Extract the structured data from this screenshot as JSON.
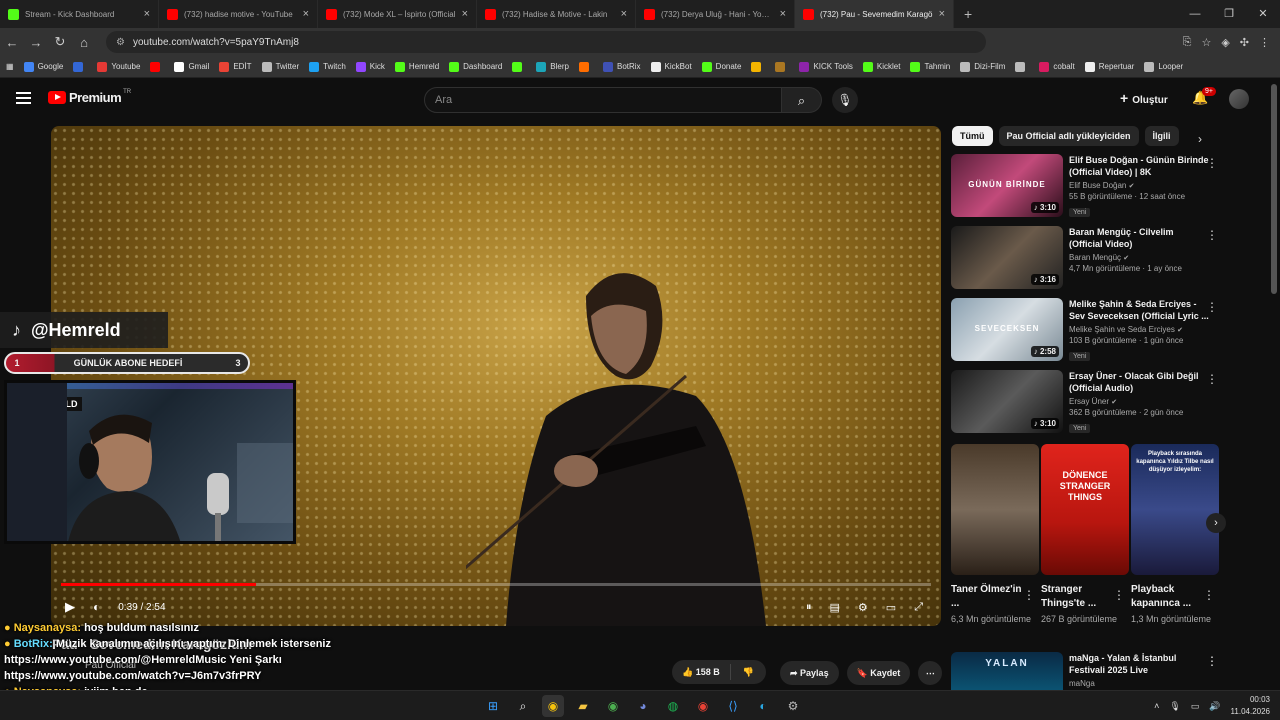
{
  "browser": {
    "tabs": [
      {
        "title": "Stream - Kick Dashboard",
        "favicon_color": "#53fc18",
        "active": false
      },
      {
        "title": "(732) hadise motive - YouTube",
        "favicon_color": "#ff0000",
        "active": false
      },
      {
        "title": "(732) Mode XL – İspirto (Official",
        "favicon_color": "#ff0000",
        "active": false
      },
      {
        "title": "(732) Hadise & Motive - Lakin",
        "favicon_color": "#ff0000",
        "active": false
      },
      {
        "title": "(732) Derya Uluğ - Hani - YouTu",
        "favicon_color": "#ff0000",
        "active": false
      },
      {
        "title": "(732) Pau - Sevemedim Karagö",
        "favicon_color": "#ff0000",
        "active": true
      }
    ],
    "new_tab": "+",
    "url": "youtube.com/watch?v=5paY9TnAmj8",
    "bookmarks": [
      "Google",
      "",
      "Youtube",
      "",
      "Gmail",
      "EDİT",
      "Twitter",
      "Twitch",
      "Kick",
      "Hemreld",
      "Dashboard",
      "",
      "Blerp",
      "",
      "BotRix",
      "KickBot",
      "Donate",
      "",
      "",
      "KICK Tools",
      "Kicklet",
      "Tahmin",
      "Dizi-Film",
      "",
      "cobalt",
      "Repertuar",
      "Looper"
    ]
  },
  "youtube": {
    "logo": "Premium",
    "logo_tr": "TR",
    "search_placeholder": "Ara",
    "create_label": "Oluştur",
    "notif_badge": "9+"
  },
  "player": {
    "time": "0:39 / 2:54",
    "progress": 0.224
  },
  "video_info": {
    "title": "Pau - Sevemedim Karagözlüm",
    "channel": "Pau Official",
    "likes": "158 B",
    "share": "Paylaş",
    "save": "Kaydet"
  },
  "related": {
    "chips": [
      "Tümü",
      "Pau Official adlı yükleyiciden",
      "İlgili"
    ],
    "videos": [
      {
        "title": "Elif Buse Doğan - Günün Birinde (Official Video) | 8K",
        "channel": "Elif Buse Doğan",
        "views": "55 B görüntüleme · 12 saat önce",
        "new": "Yeni",
        "duration": "3:10",
        "thumb": "linear-gradient(135deg,#5a1f3a,#c24a7a 50%,#2a0e1a)",
        "thumb_text": "GÜNÜN BİRİNDE"
      },
      {
        "title": "Baran Mengüç - Cilvelim (Official Video)",
        "channel": "Baran Mengüç",
        "views": "4,7 Mn görüntüleme · 1 ay önce",
        "new": "",
        "duration": "3:16",
        "thumb": "linear-gradient(135deg,#1a1a1a,#6a5a4a 50%,#222)",
        "thumb_text": ""
      },
      {
        "title": "Melike Şahin & Seda Erciyes - Sev Seveceksen (Official Lyric ...",
        "channel": "Melike Şahin ve Seda Erciyes",
        "views": "103 B görüntüleme · 1 gün önce",
        "new": "Yeni",
        "duration": "2:58",
        "thumb": "linear-gradient(135deg,#8aa0b0,#d6dde2 50%,#7a8a95)",
        "thumb_text": "SEVECEKSEN"
      },
      {
        "title": "Ersay Üner - Olacak Gibi Değil (Official Audio)",
        "channel": "Ersay Üner",
        "views": "362 B görüntüleme · 2 gün önce",
        "new": "Yeni",
        "duration": "3:10",
        "thumb": "linear-gradient(135deg,#1a1a1a,#5a5a5a 50%,#111)",
        "thumb_text": ""
      }
    ],
    "shorts": [
      {
        "title": "Taner Ölmez'in ...",
        "views": "6,3 Mn görüntüleme",
        "thumb": "linear-gradient(180deg,#4a3a2a,#7a6a5a 50%,#2a2018)",
        "caption": ""
      },
      {
        "title": "Stranger Things'te ...",
        "views": "267 B görüntüleme",
        "thumb": "linear-gradient(180deg,#e0241c,#b8160f 60%,#6a0a05)",
        "caption": "DÖNENCE STRANGER THINGS"
      },
      {
        "title": "Playback kapanınca ...",
        "views": "1,3 Mn görüntüleme",
        "thumb": "linear-gradient(180deg,#1a2a5a,#3a4a8a 50%,#1a1a3a)",
        "caption": "Playback sırasında kapanınca Yıldız Tilbe nasıl düşüyor izleyelim:"
      }
    ],
    "last": {
      "title": "maNga - Yalan & İstanbul Festivali 2025 Live",
      "channel": "maNga",
      "thumb_text": "YALAN"
    }
  },
  "stream_overlay": {
    "tiktok_handle": "@Hemreld",
    "goal_current": "1",
    "goal_label": "GÜNLÜK ABONE HEDEFİ",
    "goal_target": "3",
    "cam_logo": "HEMRELD"
  },
  "chat": [
    {
      "user": "Naysanaysa:",
      "msg": "hoş buldum nasılsınız"
    },
    {
      "user": "BotRix:",
      "msg": "Müzik kanalımın açılışını yaptım. Dinlemek isterseniz https://www.youtube.com/@HemreldMusic Yeni Şarkı https://www.youtube.com/watch?v=J6m7v3frPRY"
    },
    {
      "user": "Naysanaysa:",
      "msg": "iyiim ben de"
    }
  ],
  "taskbar": {
    "time": "00:03",
    "date": "11.04.2026"
  }
}
